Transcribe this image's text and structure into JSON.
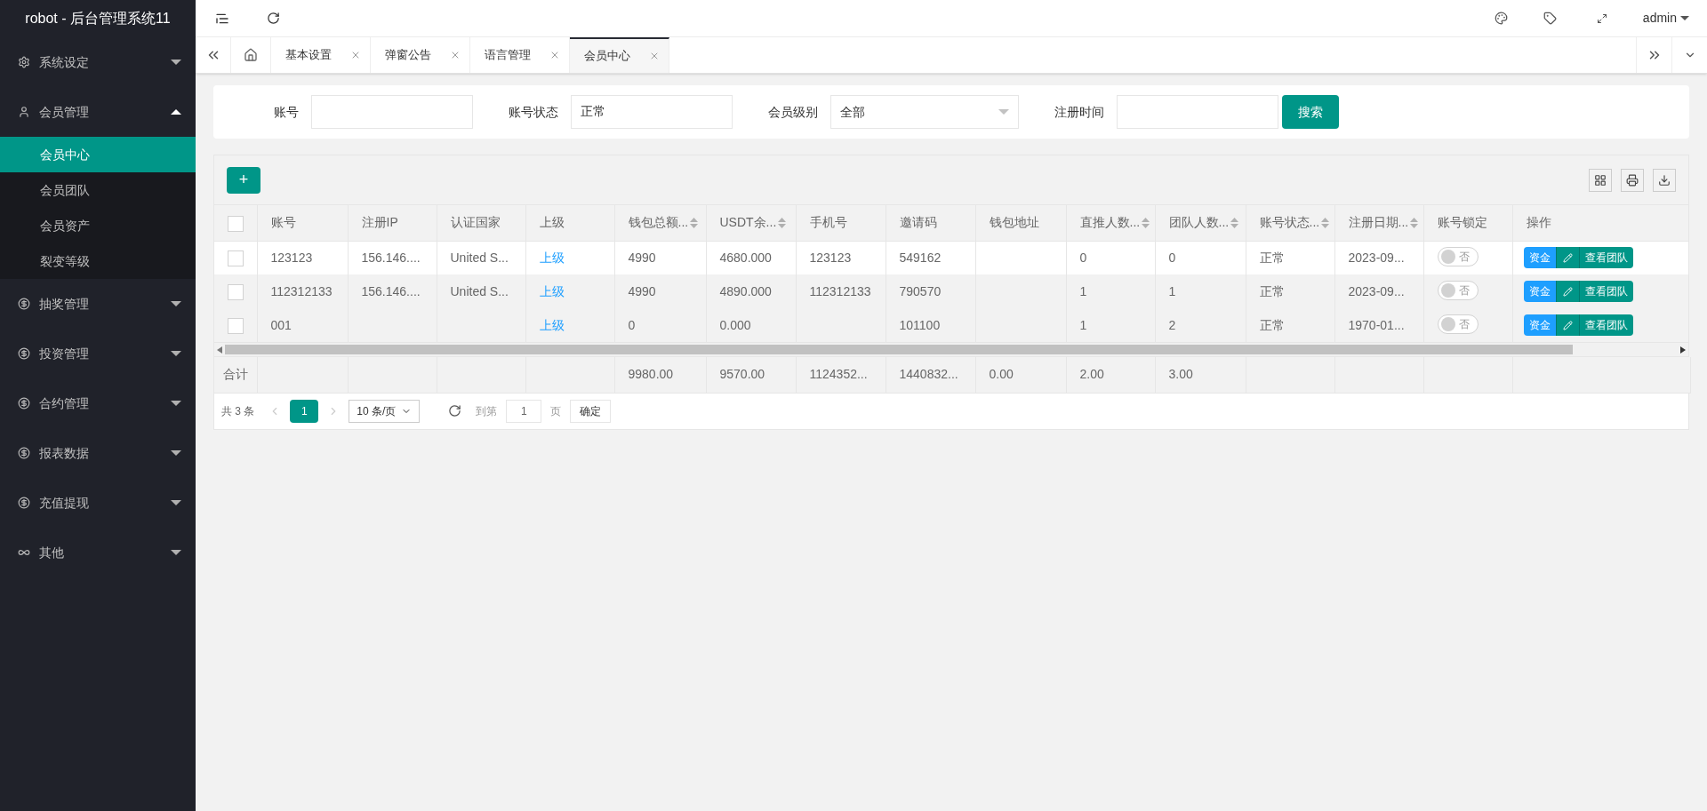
{
  "app_title": "robot - 后台管理系统11",
  "sidebar": {
    "items": [
      {
        "label": "系统设定",
        "expanded": false
      },
      {
        "label": "会员管理",
        "expanded": true,
        "children": [
          {
            "label": "会员中心",
            "selected": true
          },
          {
            "label": "会员团队",
            "selected": false
          },
          {
            "label": "会员资产",
            "selected": false
          },
          {
            "label": "裂变等级",
            "selected": false
          }
        ]
      },
      {
        "label": "抽奖管理",
        "expanded": false
      },
      {
        "label": "投资管理",
        "expanded": false
      },
      {
        "label": "合约管理",
        "expanded": false
      },
      {
        "label": "报表数据",
        "expanded": false
      },
      {
        "label": "充值提现",
        "expanded": false
      },
      {
        "label": "其他",
        "expanded": false
      }
    ]
  },
  "header": {
    "user": "admin"
  },
  "tabs": [
    {
      "label": "基本设置",
      "selected": false
    },
    {
      "label": "弹窗公告",
      "selected": false
    },
    {
      "label": "语言管理",
      "selected": false
    },
    {
      "label": "会员中心",
      "selected": true
    }
  ],
  "filters": [
    {
      "label": "账号",
      "kind": "input"
    },
    {
      "label": "账号状态",
      "kind": "input",
      "value": "正常"
    },
    {
      "label": "会员级别",
      "kind": "select",
      "value": "全部"
    },
    {
      "label": "注册时间",
      "kind": "input"
    }
  ],
  "search_button": "搜索",
  "add_button": "+",
  "table": {
    "select_all_checked": false,
    "columns": [
      {
        "label": "账号",
        "sortable": false
      },
      {
        "label": "注册IP",
        "sortable": false
      },
      {
        "label": "认证国家",
        "sortable": false
      },
      {
        "label": "上级",
        "sortable": false
      },
      {
        "label": "钱包总额...",
        "sortable": true
      },
      {
        "label": "USDT余...",
        "sortable": true
      },
      {
        "label": "手机号",
        "sortable": false
      },
      {
        "label": "邀请码",
        "sortable": false
      },
      {
        "label": "钱包地址",
        "sortable": false
      },
      {
        "label": "直推人数...",
        "sortable": true
      },
      {
        "label": "团队人数...",
        "sortable": true
      },
      {
        "label": "账号状态...",
        "sortable": true
      },
      {
        "label": "注册日期...",
        "sortable": true
      },
      {
        "label": "账号锁定",
        "sortable": false
      },
      {
        "label": "操作",
        "sortable": false
      }
    ],
    "rows": [
      {
        "highlighted": false,
        "checked": false,
        "cells": [
          "123123",
          "156.146....",
          "United S...",
          "上级",
          "4990",
          "4680.000",
          "123123",
          "549162",
          "",
          "0",
          "0",
          "正常",
          "2023-09..."
        ],
        "locked": false,
        "lock_label": "否",
        "actions": [
          "资金",
          "查看团队"
        ]
      },
      {
        "highlighted": true,
        "checked": false,
        "cells": [
          "112312133",
          "156.146....",
          "United S...",
          "上级",
          "4990",
          "4890.000",
          "112312133",
          "790570",
          "",
          "1",
          "1",
          "正常",
          "2023-09..."
        ],
        "locked": false,
        "lock_label": "否",
        "actions": [
          "资金",
          "查看团队"
        ]
      },
      {
        "highlighted": true,
        "checked": false,
        "cells": [
          "001",
          "",
          "",
          "上级",
          "0",
          "0.000",
          "",
          "101100",
          "",
          "1",
          "2",
          "正常",
          "1970-01..."
        ],
        "locked": false,
        "lock_label": "否",
        "actions": [
          "资金",
          "查看团队"
        ]
      }
    ],
    "totals": {
      "label": "合计",
      "cells": [
        "",
        "",
        "",
        "",
        "9980.00",
        "9570.00",
        "1124352...",
        "1440832...",
        "0.00",
        "2.00",
        "3.00",
        "",
        "",
        "",
        ""
      ]
    }
  },
  "pagination": {
    "total": "共 3 条",
    "pages": [
      {
        "label": "1",
        "selected": true
      }
    ],
    "page_size": "10 条/页",
    "goto_label": "到第",
    "goto_value": "1",
    "page_unit": "页",
    "confirm": "确定"
  }
}
